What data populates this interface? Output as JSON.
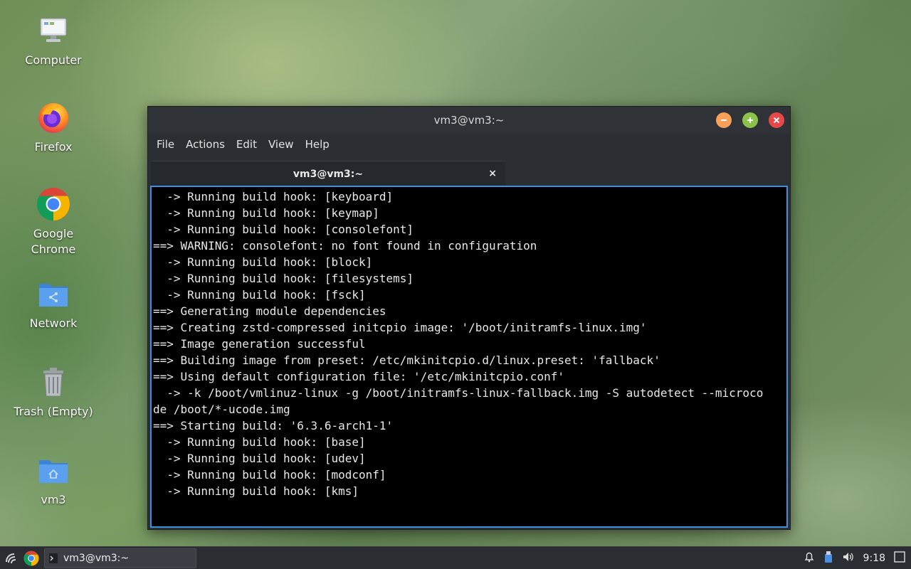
{
  "desktop": {
    "icons": [
      {
        "label": "Computer"
      },
      {
        "label": "Firefox"
      },
      {
        "label": "Google\nChrome"
      },
      {
        "label": "Network"
      },
      {
        "label": "Trash (Empty)"
      },
      {
        "label": "vm3"
      }
    ]
  },
  "window": {
    "title": "vm3@vm3:~",
    "menu": [
      "File",
      "Actions",
      "Edit",
      "View",
      "Help"
    ],
    "tab_label": "vm3@vm3:~",
    "tab_close": "×"
  },
  "terminal": {
    "lines": [
      "  -> Running build hook: [keyboard]",
      "  -> Running build hook: [keymap]",
      "  -> Running build hook: [consolefont]",
      "==> WARNING: consolefont: no font found in configuration",
      "  -> Running build hook: [block]",
      "  -> Running build hook: [filesystems]",
      "  -> Running build hook: [fsck]",
      "==> Generating module dependencies",
      "==> Creating zstd-compressed initcpio image: '/boot/initramfs-linux.img'",
      "==> Image generation successful",
      "==> Building image from preset: /etc/mkinitcpio.d/linux.preset: 'fallback'",
      "==> Using default configuration file: '/etc/mkinitcpio.conf'",
      "  -> -k /boot/vmlinuz-linux -g /boot/initramfs-linux-fallback.img -S autodetect --microco",
      "de /boot/*-ucode.img",
      "==> Starting build: '6.3.6-arch1-1'",
      "  -> Running build hook: [base]",
      "  -> Running build hook: [udev]",
      "  -> Running build hook: [modconf]",
      "  -> Running build hook: [kms]"
    ]
  },
  "taskbar": {
    "task_label": "vm3@vm3:~",
    "clock": "9:18"
  }
}
